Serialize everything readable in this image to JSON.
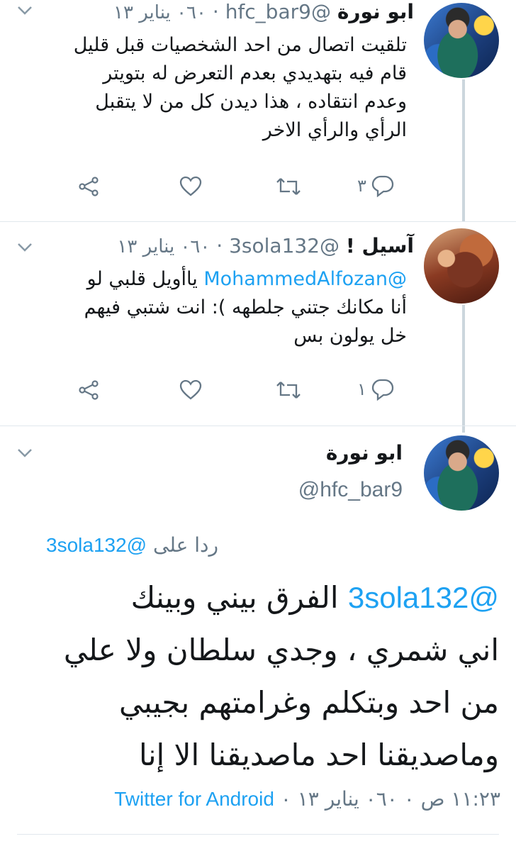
{
  "tweets": [
    {
      "name": "ابو نورة",
      "handle": "@hfc_bar9",
      "date": "٠٦٠ يناير ١٣",
      "text_lines": [
        "تلقيت اتصال من احد الشخصيات قبل قليل",
        "قام فيه بتهديدي بعدم التعرض له بتويتر",
        "وعدم انتقاده ، هذا ديدن كل من لا يتقبل",
        "الرأي والرأي الاخر"
      ],
      "reply_count": "٣"
    },
    {
      "name": "آسيل !",
      "handle": "@3sola132",
      "date": "٠٦٠ يناير ١٣",
      "mention": "@MohammedAlfozan",
      "line1_rest": "ياأويل قلبي لو",
      "text_lines": [
        "أنا مكانك جتني جلطهه ): انت شتبي فيهم",
        "خل يولون بس"
      ],
      "reply_count": "١"
    }
  ],
  "main_tweet": {
    "name": "ابو نورة",
    "handle": "@hfc_bar9",
    "replying_label": "ردا على",
    "replying_to": "@3sola132",
    "mention": "@3sola132",
    "line1_rest": "الفرق بيني وبينك",
    "text_lines": [
      "اني شمري ، وجدي سلطان ولا علي",
      "من احد وبتكلم وغرامتهم بجيبي",
      "وماصديقنا احد ماصديقنا الا إنا"
    ],
    "time": "١١:٢٣ ص ٠ ٠٦٠ يناير ١٣ ٠",
    "source": "Twitter for Android"
  },
  "colors": {
    "accent": "#1da1f2",
    "muted": "#657786",
    "line": "#ccd6dd"
  },
  "icons": [
    "share-icon",
    "like-icon",
    "retweet-icon",
    "reply-icon",
    "chevron-down-icon"
  ]
}
